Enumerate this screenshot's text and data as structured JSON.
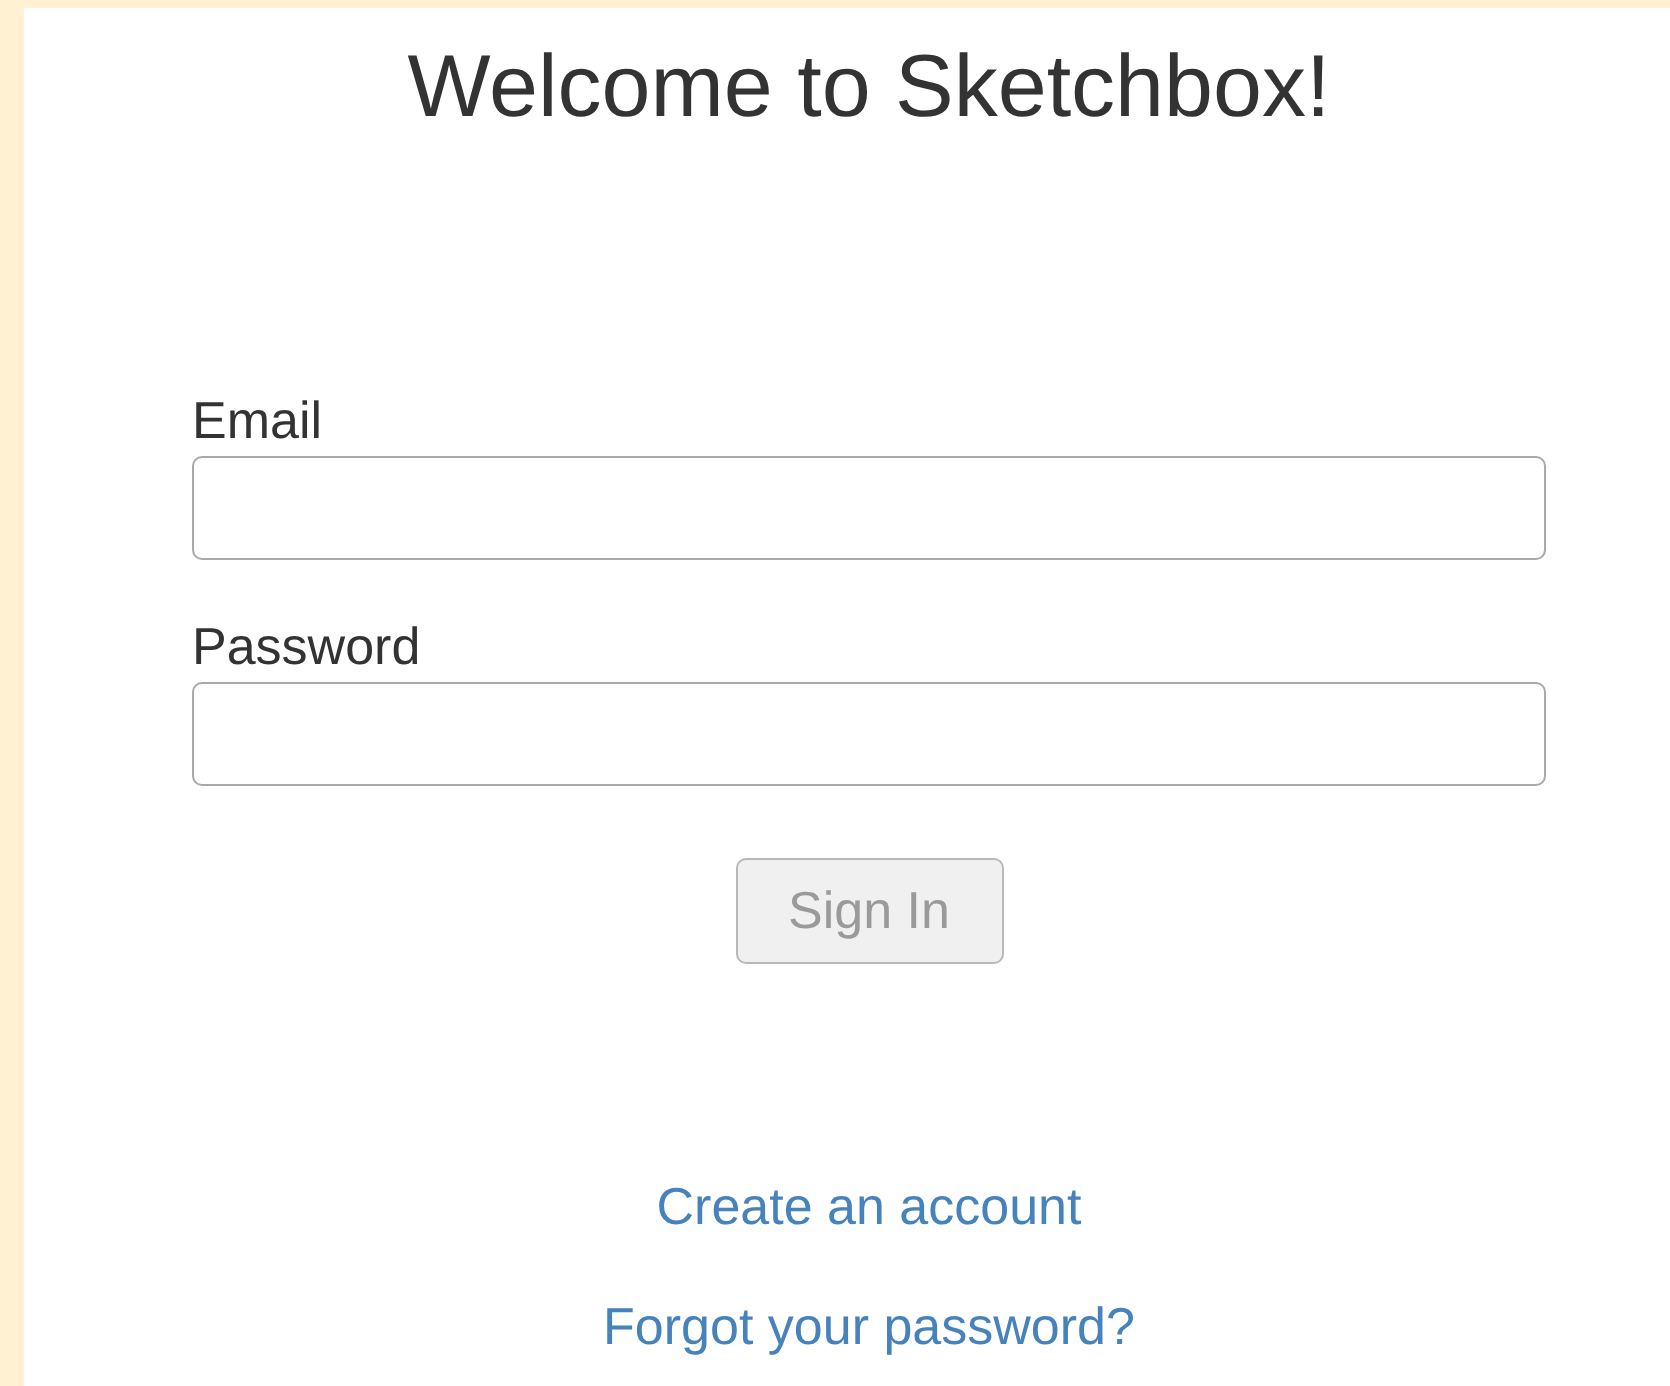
{
  "title": "Welcome to Sketchbox!",
  "fields": [
    {
      "label": "Email"
    },
    {
      "label": "Password"
    }
  ],
  "sign_in_button": {
    "label": "Sign In",
    "disabled": true
  },
  "links": [
    "Create an account",
    "Forgot your password?"
  ]
}
